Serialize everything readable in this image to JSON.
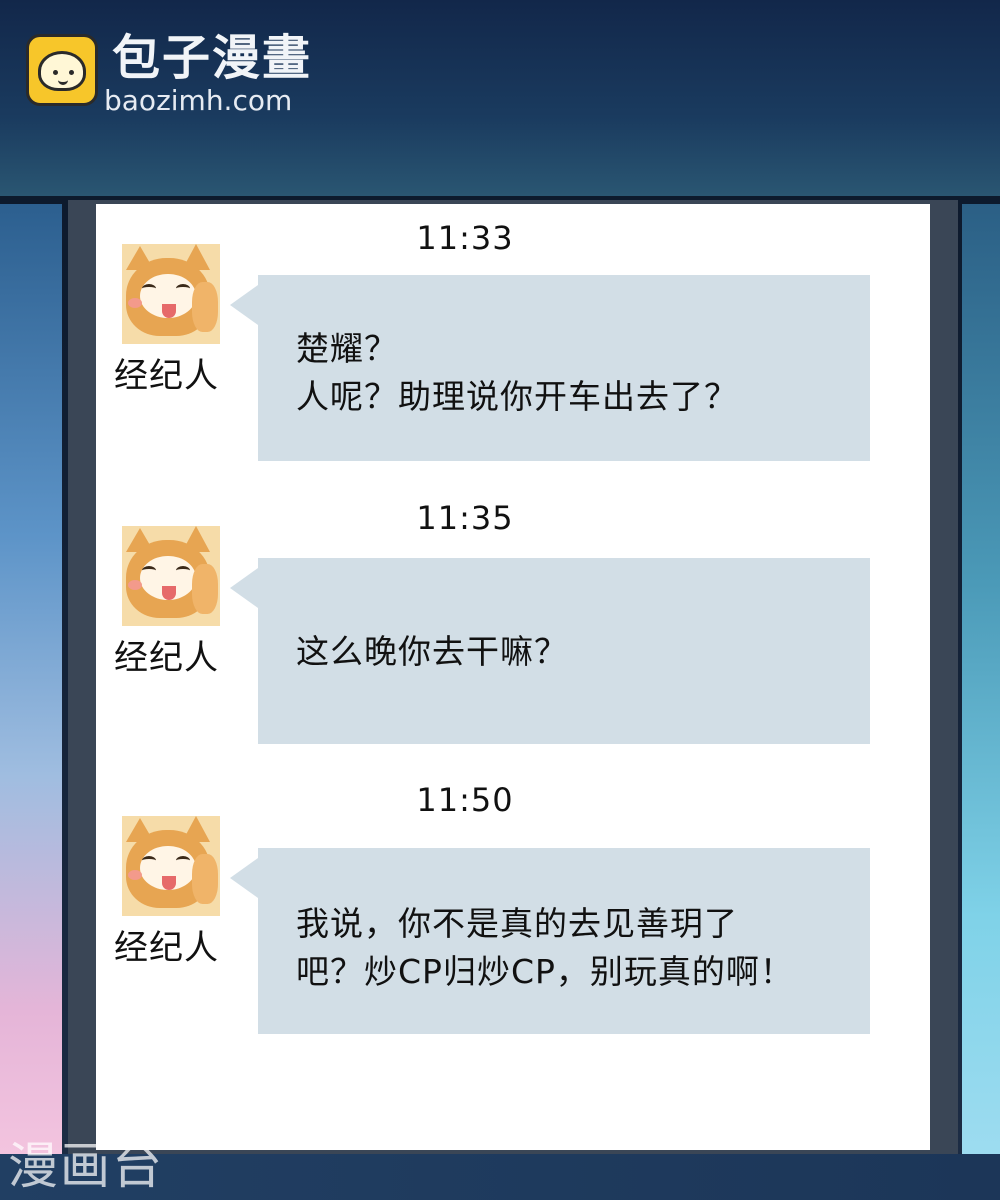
{
  "header": {
    "logo_icon": "steamed-bun-icon",
    "site_name": "包子漫畫",
    "site_url": "baozimh.com"
  },
  "messages": [
    {
      "time": "11:33",
      "sender": "经纪人",
      "avatar": "shiba-dog-avatar",
      "text": "楚耀？\n人呢？助理说你开车出去了？"
    },
    {
      "time": "11:35",
      "sender": "经纪人",
      "avatar": "shiba-dog-avatar",
      "text": "这么晚你去干嘛？"
    },
    {
      "time": "11:50",
      "sender": "经纪人",
      "avatar": "shiba-dog-avatar",
      "text": "我说，你不是真的去见善玥了\n吧？炒CP归炒CP，别玩真的啊！"
    }
  ],
  "footer": {
    "watermark": "漫画台"
  },
  "colors": {
    "bubble": "#d2dee6",
    "screen": "#ffffff",
    "logo_yellow": "#f7c62a"
  }
}
